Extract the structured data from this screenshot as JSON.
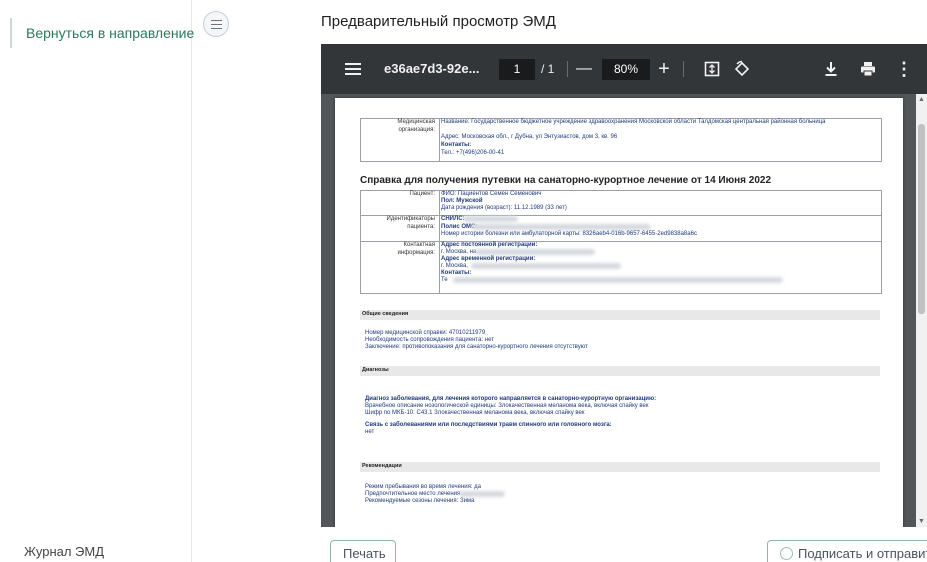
{
  "sidebar": {
    "back_label": "Вернуться в направление",
    "journal_label": "Журнал ЭМД"
  },
  "title": "Предварительный просмотр ЭМД",
  "viewer": {
    "file_name": "e36ae7d3-92e...",
    "page_current": "1",
    "page_total": "/ 1",
    "zoom": "80%"
  },
  "doc": {
    "org_label": "Медицинская организация:",
    "org_name": "Название: Государственное бюджетное учреждение здравоохранения Московской области Талдомская центральная районная больница",
    "org_address": "Адрес: Московская обл., г Дубна, ул Энтузиастов, дом 3, кв. 96",
    "org_contacts_label": "Контакты:",
    "org_phone": "Тел.: +7(496)206-00-41",
    "title": "Справка для получения путевки на санаторно-курортное лечение от 14 Июня 2022",
    "patient_label": "Пациент:",
    "patient_fio": "ФИО: Пациентов Семен Семенович",
    "patient_sex": "Пол: Мужской",
    "patient_birth": "Дата рождения (возраст): 11.12.1989 (33 лет)",
    "ident_label": "Идентификаторы пациента:",
    "snils": "СНИЛС:",
    "oms": "Полис ОМС:",
    "history": "Номер истории болезни или амбулаторной карты: 8326aeb4-016b-9657-6455-2ed9838a8a6c",
    "contact_label": "Контактная информация:",
    "perm_addr_label": "Адрес постоянной регистрации:",
    "perm_addr": "г. Москва, на",
    "temp_addr_label": "Адрес временной регистрации:",
    "temp_addr": "г. Москва,",
    "contacts_label": "Контакты:",
    "phone_short": "Те",
    "sec_general": "Общие сведения",
    "gen_1": "Номер медицинской справки: 47010211979",
    "gen_2": "Необходимость сопровождения пациента: нет",
    "gen_3": "Заключение: противопоказания для санаторно-курортного лечения отсутствуют",
    "sec_diag": "Диагнозы",
    "diag_head": "Диагноз заболевания, для лечения которого направляется в санаторно-курортную организацию:",
    "diag_1": "Врачебное описание нозологической единицы: Злокачественная меланома века, включая спайку век",
    "diag_2": "Шифр по МКБ-10: C43.1 Злокачественная меланома века, включая спайку век",
    "diag_link_head": "Связь с заболеваниями или последствиями травм спинного или головного мозга:",
    "diag_link_val": "нет",
    "sec_rec": "Рекомендации",
    "rec_1": "Режим пребывания во время лечения: да",
    "rec_2": "Предпочтительное место лечения:",
    "rec_3": "Рекомендуемые сезоны лечения: Зима"
  },
  "buttons": {
    "print": "Печать",
    "sign": "Подписать и отправить"
  }
}
